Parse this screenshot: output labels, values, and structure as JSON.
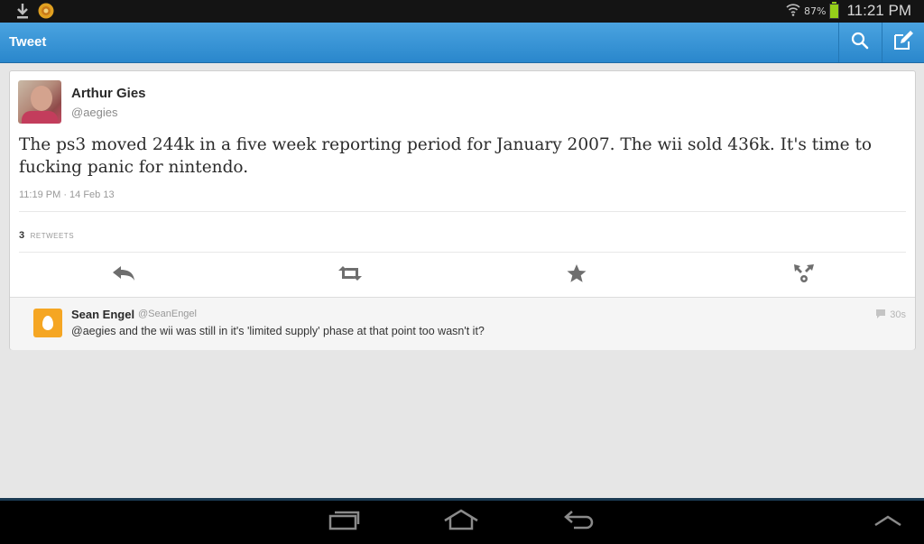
{
  "status_bar": {
    "battery_percent": "87%",
    "time": "11:21 PM",
    "left_icons": [
      "download-icon",
      "notification-app-icon"
    ],
    "right_icons": [
      "wifi-icon",
      "battery-icon"
    ]
  },
  "action_bar": {
    "title": "Tweet",
    "buttons": [
      "search-icon",
      "compose-icon"
    ],
    "accent_color": "#3396d8"
  },
  "tweet": {
    "author_name": "Arthur Gies",
    "author_handle": "@aegies",
    "text": "The ps3 moved 244k in a five week reporting period for January 2007. The wii sold 436k. It's time to fucking panic for nintendo.",
    "timestamp": "11:19 PM · 14 Feb 13",
    "retweet_count": "3",
    "retweet_label": "RETWEETS",
    "actions": [
      "reply-icon",
      "retweet-icon",
      "favorite-icon",
      "share-icon"
    ]
  },
  "reply": {
    "author_name": "Sean Engel",
    "author_handle": "@SeanEngel",
    "text": "@aegies and the wii was still in it's 'limited supply' phase at that point too wasn't it?",
    "time": "30s",
    "avatar_color": "#f5a623"
  },
  "nav_bar": {
    "buttons": [
      "recent-apps-icon",
      "home-icon",
      "back-icon",
      "menu-up-icon"
    ]
  }
}
